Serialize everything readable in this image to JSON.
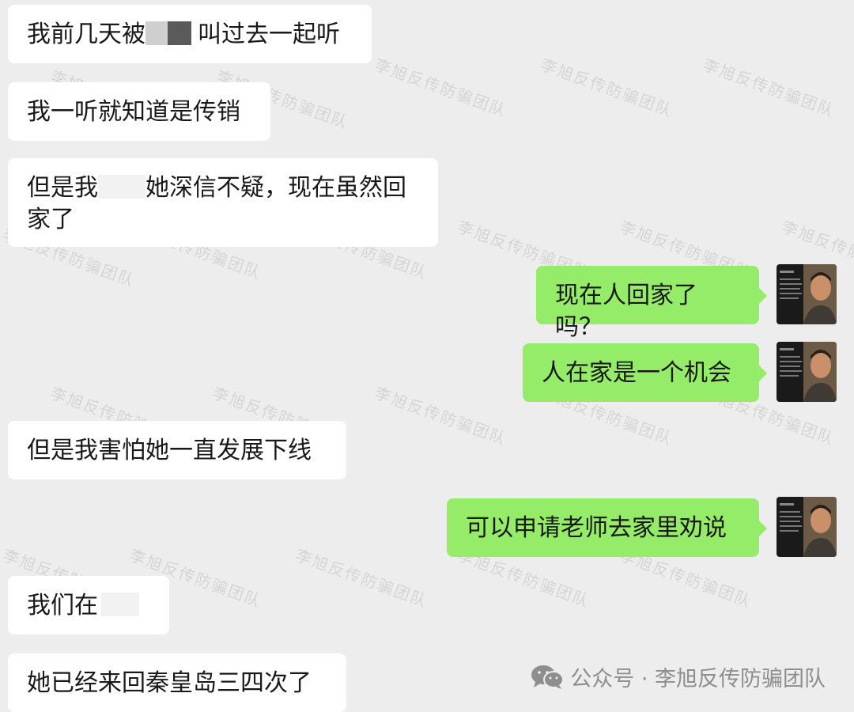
{
  "watermark_text": "李旭反传防骗团队",
  "messages": [
    {
      "side": "in",
      "parts": [
        "我前几天被",
        "叫过去一起听"
      ]
    },
    {
      "side": "in",
      "text": "我一听就知道是传销"
    },
    {
      "side": "in",
      "parts": [
        "但是我",
        "她深信不疑，现在虽然回"
      ],
      "line2": "家了"
    },
    {
      "side": "out",
      "text": "现在人回家了吗？"
    },
    {
      "side": "out",
      "text": "人在家是一个机会"
    },
    {
      "side": "in",
      "text": "但是我害怕她一直发展下线"
    },
    {
      "side": "out",
      "text": "可以申请老师去家里劝说"
    },
    {
      "side": "in",
      "parts": [
        "我们在"
      ]
    },
    {
      "side": "in",
      "text": "她已经来回秦皇岛三四次了"
    }
  ],
  "footer": {
    "label": "公众号 · 李旭反传防骗团队",
    "icon": "wechat-icon"
  },
  "colors": {
    "background": "#ededed",
    "incoming": "#ffffff",
    "outgoing": "#95ec69"
  }
}
